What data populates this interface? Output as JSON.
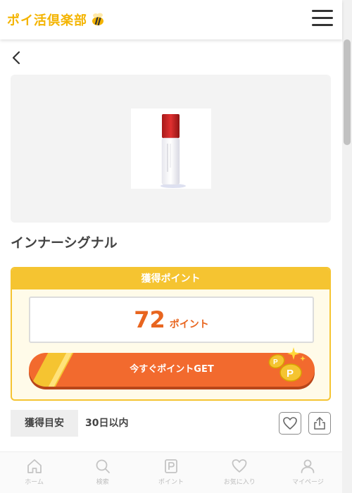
{
  "header": {
    "logo_text": "ポイ活倶楽部",
    "logo_icon": "bee-icon",
    "menu_icon": "hamburger-menu-icon"
  },
  "nav": {
    "back_icon": "chevron-left-icon"
  },
  "product": {
    "title": "インナーシグナル",
    "image_icon": "serum-bottle-image"
  },
  "points": {
    "header": "獲得ポイント",
    "value": "72",
    "unit": "ポイント",
    "get_button": "今すぐポイントGET"
  },
  "estimate": {
    "label": "獲得目安",
    "value": "30日以内"
  },
  "actions": {
    "favorite_icon": "heart-icon",
    "share_icon": "share-icon"
  },
  "bottom_nav": [
    {
      "label": "ホーム",
      "icon": "home-icon"
    },
    {
      "label": "検索",
      "icon": "search-icon"
    },
    {
      "label": "ポイント",
      "icon": "point-p-icon"
    },
    {
      "label": "お気に入り",
      "icon": "heart-icon"
    },
    {
      "label": "マイページ",
      "icon": "user-icon"
    }
  ],
  "colors": {
    "accent_orange": "#f26a2e",
    "accent_yellow": "#f5c431",
    "text": "#333333"
  }
}
